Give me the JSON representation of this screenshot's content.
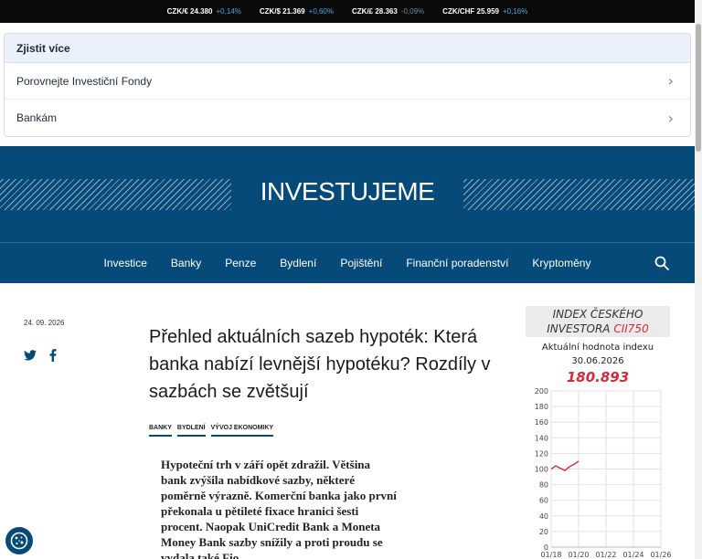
{
  "ticker": [
    {
      "pair": "CZK/€ 24.380",
      "change": "+0,14%",
      "dir": "pos"
    },
    {
      "pair": "CZK/$ 21.369",
      "change": "+0,60%",
      "dir": "pos"
    },
    {
      "pair": "CZK/£ 28.363",
      "change": "-0,09%",
      "dir": "neg"
    },
    {
      "pair": "CZK/CHF 25.959",
      "change": "+0,16%",
      "dir": "pos"
    }
  ],
  "more": {
    "heading": "Zjistit více",
    "links": [
      "Porovnejte Investiční Fondy",
      "Bankám"
    ]
  },
  "logo": "INVESTUJEME",
  "nav": [
    "Investice",
    "Banky",
    "Penze",
    "Bydlení",
    "Pojištění",
    "Finanční poradenství",
    "Kryptoměny"
  ],
  "article": {
    "date": "24. 09. 2026",
    "title": "Přehled aktuálních sazeb hypoték: Která banka nabízí levnější hypotéku? Rozdíly v sazbách se zvětšují",
    "tags": [
      "BANKY",
      "BYDLENÍ",
      "VÝVOJ EKONOMIKY"
    ],
    "lead": "Hypoteční trh v září opět zdražil. Většina bank zvýšila nabídkové sazby, některé poměrně výrazně. Komerční banka jako první překonala u pětileté fixace hranici šesti procent. Naopak UniCredit Bank a Moneta Money Bank sazby snížily a proti proudu se vydala také Fio"
  },
  "widget": {
    "title_line1": "INDEX ČESKÉHO",
    "title_line2": "INVESTORA",
    "title_code": "CII750",
    "subtitle": "Aktuální hodnota indexu",
    "date": "30.06.2026",
    "value": "180.893"
  },
  "colors": {
    "brand": "#064a7a",
    "accent_red": "#d42a3c",
    "ticker_positive": "#4aa8e8"
  },
  "chart_data": {
    "type": "line",
    "x": [
      "01/18",
      "01/19",
      "01/19",
      "01/20",
      "01/20",
      "01/20",
      "01/20"
    ],
    "values": [
      100,
      104,
      101,
      98,
      103,
      106,
      110
    ],
    "xticks": [
      "01/18",
      "01/20",
      "01/22",
      "01/24",
      "01/26"
    ],
    "yticks": [
      0,
      20,
      40,
      60,
      80,
      100,
      120,
      140,
      160,
      180,
      200
    ],
    "ylim": [
      0,
      200
    ],
    "grid": true,
    "line_color": "#d42a3c"
  }
}
